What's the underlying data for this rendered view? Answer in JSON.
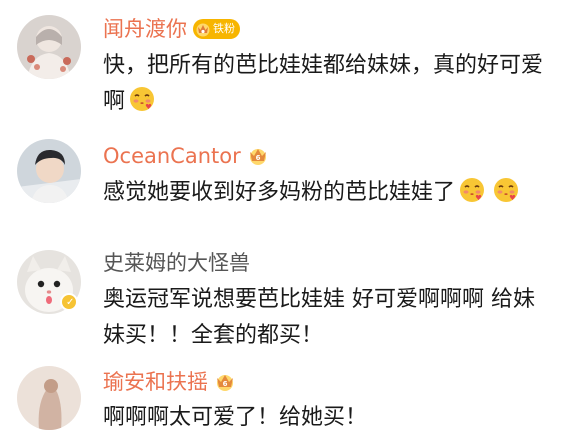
{
  "comments": [
    {
      "username": "闻舟渡你",
      "fan_badge": "铁粉",
      "text_lines": [
        "快，把所有的芭比娃娃都给妹妹，真的好可爱",
        "啊"
      ],
      "emoji": "kissing-face-emoji"
    },
    {
      "username": "OceanCantor",
      "text_lines": [
        "感觉她要收到好多妈粉的芭比娃娃了"
      ],
      "emoji": "kissing-face-emoji"
    },
    {
      "username": "史莱姆的大怪兽",
      "text_lines": [
        "奥运冠军说想要芭比娃娃 好可爱啊啊啊  给妹",
        "妹买！！全套的都买！"
      ]
    },
    {
      "username": "瑜安和扶摇",
      "text_lines": [
        "啊啊啊太可爱了！给她买！"
      ]
    }
  ],
  "colors": {
    "vip_name": "#eb7350",
    "normal_name": "#555555",
    "text": "#1a1a1a",
    "badge": "#f7b500"
  }
}
